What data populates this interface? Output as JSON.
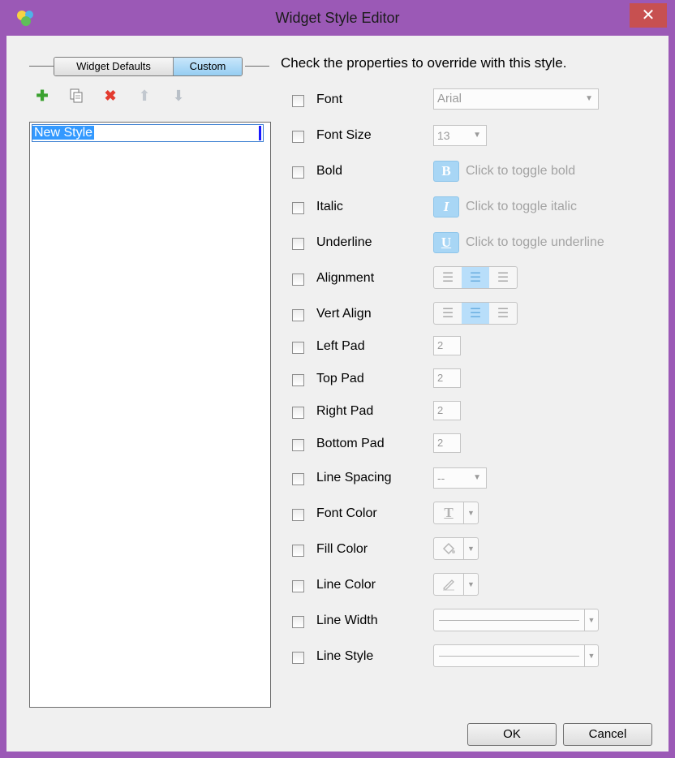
{
  "window": {
    "title": "Widget Style Editor",
    "close_label": "✕",
    "app_icon": "app-logo-icon"
  },
  "tabs": {
    "defaults_label": "Widget Defaults",
    "custom_label": "Custom"
  },
  "toolbar": {
    "icons": [
      "add-icon",
      "copy-icon",
      "delete-icon",
      "move-up-icon",
      "move-down-icon"
    ]
  },
  "styles": {
    "items": [
      "New Style"
    ]
  },
  "instructions": "Check the properties to override with this style.",
  "properties": {
    "font": {
      "label": "Font",
      "value": "Arial"
    },
    "font_size": {
      "label": "Font Size",
      "value": "13"
    },
    "bold": {
      "label": "Bold",
      "icon_text": "B",
      "hint": "Click to toggle bold"
    },
    "italic": {
      "label": "Italic",
      "icon_text": "I",
      "hint": "Click to toggle italic"
    },
    "underline": {
      "label": "Underline",
      "icon_text": "U",
      "hint": "Click to toggle underline"
    },
    "alignment": {
      "label": "Alignment",
      "selected": "center"
    },
    "vert_align": {
      "label": "Vert Align",
      "selected": "middle"
    },
    "left_pad": {
      "label": "Left Pad",
      "value": "2"
    },
    "top_pad": {
      "label": "Top Pad",
      "value": "2"
    },
    "right_pad": {
      "label": "Right Pad",
      "value": "2"
    },
    "bottom_pad": {
      "label": "Bottom Pad",
      "value": "2"
    },
    "line_spacing": {
      "label": "Line Spacing",
      "value": "--"
    },
    "font_color": {
      "label": "Font Color",
      "icon": "text-color-icon"
    },
    "fill_color": {
      "label": "Fill Color",
      "icon": "paint-bucket-icon"
    },
    "line_color": {
      "label": "Line Color",
      "icon": "pencil-icon"
    },
    "line_width": {
      "label": "Line Width"
    },
    "line_style": {
      "label": "Line Style"
    }
  },
  "buttons": {
    "ok": "OK",
    "cancel": "Cancel"
  }
}
